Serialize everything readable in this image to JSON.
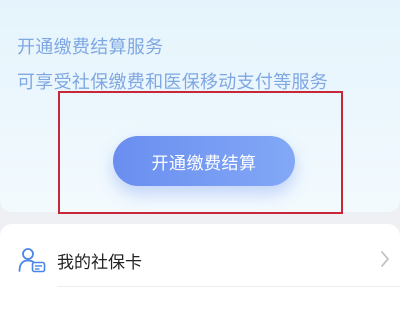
{
  "promo": {
    "title": "开通缴费结算服务",
    "subtitle": "可享受社保缴费和医保移动支付等服务",
    "button_label": "开通缴费结算"
  },
  "list": {
    "items": [
      {
        "label": "我的社保卡",
        "icon": "person-card-icon"
      }
    ]
  },
  "colors": {
    "promo_text": "#7fa7e3",
    "button_start": "#6a8ef0",
    "button_end": "#82a8f6",
    "highlight_border": "#c8273a",
    "icon_blue": "#4a86e8"
  }
}
